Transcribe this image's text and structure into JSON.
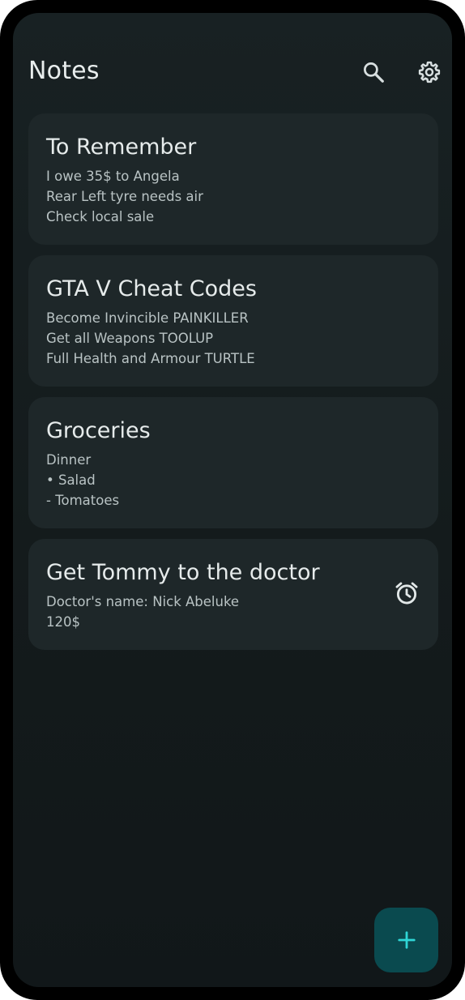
{
  "header": {
    "title": "Notes",
    "search_icon": "search-icon",
    "settings_icon": "gear-icon"
  },
  "notes": [
    {
      "title": "To Remember",
      "lines": [
        "I owe 35$ to Angela",
        "Rear Left tyre needs air",
        "Check local sale"
      ]
    },
    {
      "title": "GTA V Cheat Codes",
      "lines": [
        "Become Invincible PAINKILLER",
        "Get all Weapons TOOLUP",
        "Full Health and Armour TURTLE"
      ]
    },
    {
      "title": "Groceries",
      "lines": [
        "Dinner",
        "• Salad",
        "- Tomatoes"
      ]
    },
    {
      "title": "Get Tommy to the doctor",
      "lines": [
        "Doctor's name: Nick Abeluke",
        "120$"
      ],
      "reminder_icon": "alarm-clock-icon"
    }
  ],
  "fab": {
    "icon": "plus-icon"
  },
  "colors": {
    "background": "#141b1c",
    "card": "#1e2729",
    "fab": "#0a4a4f",
    "fab_icon": "#2fd6d6"
  }
}
